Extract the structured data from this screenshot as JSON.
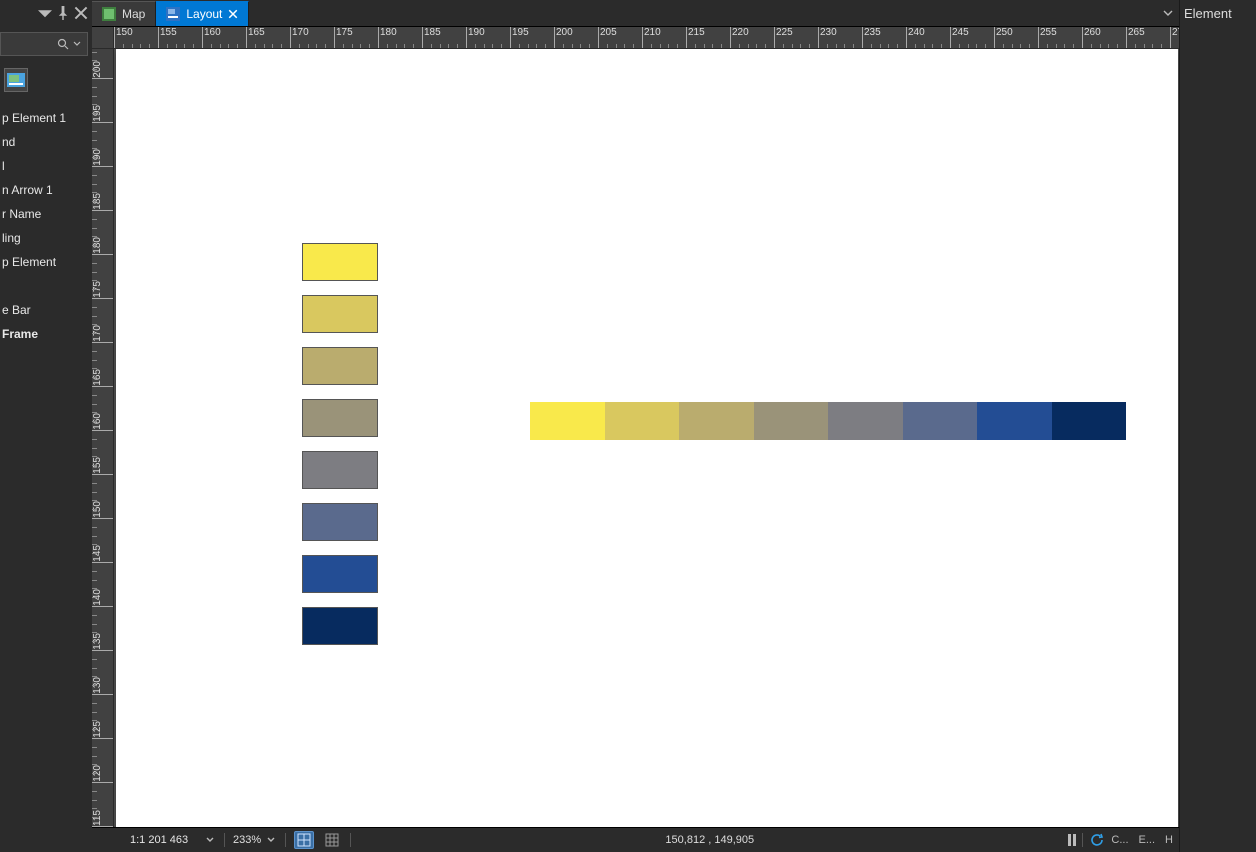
{
  "left": {
    "search_placeholder": "",
    "items": [
      "p Element 1",
      "nd",
      "l",
      "n Arrow 1",
      "r Name",
      "ling",
      "p Element",
      "",
      "e Bar",
      "Frame"
    ]
  },
  "tabs": {
    "map": "Map",
    "layout": "Layout"
  },
  "ruler_h": {
    "start": 150,
    "step": 5,
    "count": 25
  },
  "ruler_v": {
    "start": 115,
    "step": 5,
    "count": 19
  },
  "colors": [
    "#f9e94b",
    "#d9c85f",
    "#baac6e",
    "#9a9379",
    "#7d7d82",
    "#5a6a8d",
    "#234d94",
    "#072b5f"
  ],
  "status": {
    "scale": "1:1 201 463",
    "zoom": "233%",
    "coord": "150,812 , 149,905",
    "letters": [
      "C...",
      "E...",
      "H"
    ]
  },
  "right": {
    "title": "Element"
  }
}
